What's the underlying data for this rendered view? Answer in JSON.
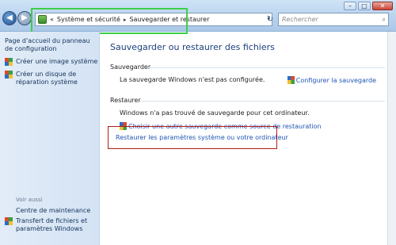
{
  "window": {
    "minimize": "–",
    "maximize": "□",
    "close": "✕"
  },
  "address": {
    "back": "◀",
    "forward": "▶",
    "overflow": "«",
    "crumb1": "Système et sécurité",
    "crumb2": "Sauvegarder et restaurer",
    "separator": "▸",
    "dropdown": "▾",
    "refresh": "↻"
  },
  "search": {
    "placeholder": "Rechercher",
    "icon": "⌕"
  },
  "sidebar": {
    "home_link": "Page d'accueil du panneau de configuration",
    "items": [
      "Créer une image système",
      "Créer un disque de réparation système"
    ],
    "see_also": "Voir aussi",
    "bottom_items": [
      "Centre de maintenance",
      "Transfert de fichiers et paramètres Windows"
    ]
  },
  "main": {
    "heading": "Sauvegarder ou restaurer des fichiers",
    "backup_label": "Sauvegarder",
    "backup_status": "La sauvegarde Windows n'est pas configurée.",
    "configure_link": "Configurer la sauvegarde",
    "restore_label": "Restaurer",
    "restore_status": "Windows n'a pas trouvé de sauvegarde pour cet ordinateur.",
    "choose_link": "Choisir une autre sauvegarde comme source de restauration",
    "restore_system_link": "Restaurer les paramètres système ou votre ordinateur"
  },
  "colors": {
    "highlight_green": "#3ecf4a",
    "highlight_red": "#b51a1a",
    "link": "#1f56b3",
    "heading": "#1c3f7a"
  }
}
